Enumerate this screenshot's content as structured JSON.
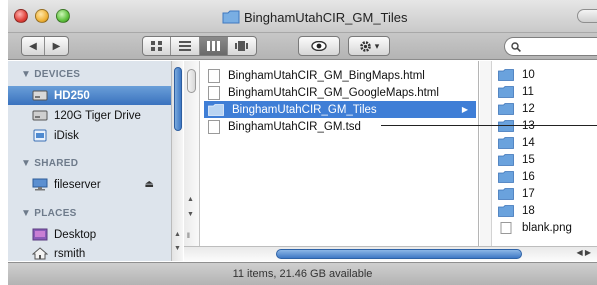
{
  "window": {
    "title": "BinghamUtahCIR_GM_Tiles"
  },
  "toolbar": {
    "back_glyph": "◀",
    "forward_glyph": "▶",
    "view_icons": [
      "icon-view-icon",
      "list-view-icon",
      "column-view-icon",
      "coverflow-view-icon"
    ],
    "active_view": "column-view-icon",
    "quicklook_glyph": "👁",
    "action_glyph": "✱",
    "action_caret": "▾",
    "search_placeholder": ""
  },
  "sidebar": {
    "headings": {
      "devices": "▼ DEVICES",
      "shared": "▼ SHARED",
      "places": "▼ PLACES"
    },
    "devices": [
      {
        "label": "HD250",
        "selected": true,
        "icon": "hard-drive-icon"
      },
      {
        "label": "120G Tiger Drive",
        "selected": false,
        "icon": "hard-drive-icon"
      },
      {
        "label": "iDisk",
        "selected": false,
        "icon": "idisk-icon"
      }
    ],
    "shared": [
      {
        "label": "fileserver",
        "icon": "server-icon",
        "eject": "⏏"
      }
    ],
    "places": [
      {
        "label": "Desktop",
        "icon": "desktop-icon"
      },
      {
        "label": "rsmith",
        "icon": "home-icon"
      }
    ]
  },
  "column1": {
    "items": [
      {
        "name": "BinghamUtahCIR_GM_BingMaps.html",
        "kind": "document",
        "selected": false
      },
      {
        "name": "BinghamUtahCIR_GM_GoogleMaps.html",
        "kind": "document",
        "selected": false
      },
      {
        "name": "BinghamUtahCIR_GM_Tiles",
        "kind": "folder",
        "selected": true,
        "arrow": "▶"
      },
      {
        "name": "BinghamUtahCIR_GM.tsd",
        "kind": "document",
        "selected": false
      }
    ]
  },
  "column2": {
    "items": [
      {
        "name": "10",
        "kind": "folder"
      },
      {
        "name": "11",
        "kind": "folder"
      },
      {
        "name": "12",
        "kind": "folder"
      },
      {
        "name": "13",
        "kind": "folder"
      },
      {
        "name": "14",
        "kind": "folder"
      },
      {
        "name": "15",
        "kind": "folder"
      },
      {
        "name": "16",
        "kind": "folder"
      },
      {
        "name": "17",
        "kind": "folder"
      },
      {
        "name": "18",
        "kind": "folder"
      },
      {
        "name": "blank.png",
        "kind": "image"
      }
    ]
  },
  "statusbar": {
    "text": "11 items, 21.46 GB available"
  },
  "colors": {
    "selection": "#3f7ed6",
    "sidebar_bg": "#dde4ec",
    "folder_blue": "#6aa2dd"
  }
}
